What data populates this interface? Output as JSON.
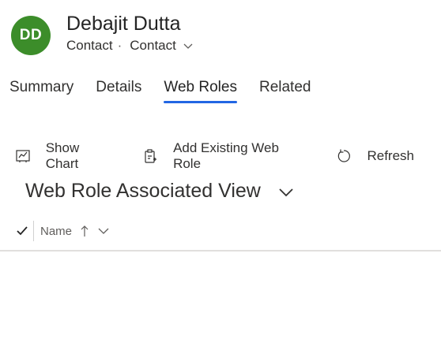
{
  "record": {
    "avatar_initials": "DD",
    "avatar_color": "#3c8d2a",
    "name": "Debajit Dutta",
    "entity": "Contact",
    "separator": "·",
    "form_selector": "Contact"
  },
  "tabs": [
    {
      "label": "Summary",
      "active": false
    },
    {
      "label": "Details",
      "active": false
    },
    {
      "label": "Web Roles",
      "active": true
    },
    {
      "label": "Related",
      "active": false
    }
  ],
  "toolbar": {
    "show_chart": "Show Chart",
    "add_existing": "Add Existing Web Role",
    "refresh": "Refresh"
  },
  "view": {
    "title": "Web Role Associated View"
  },
  "grid": {
    "columns": [
      {
        "label": "Name",
        "sort": "ascending"
      }
    ]
  },
  "colors": {
    "accent": "#2266e3",
    "text": "#242424"
  }
}
